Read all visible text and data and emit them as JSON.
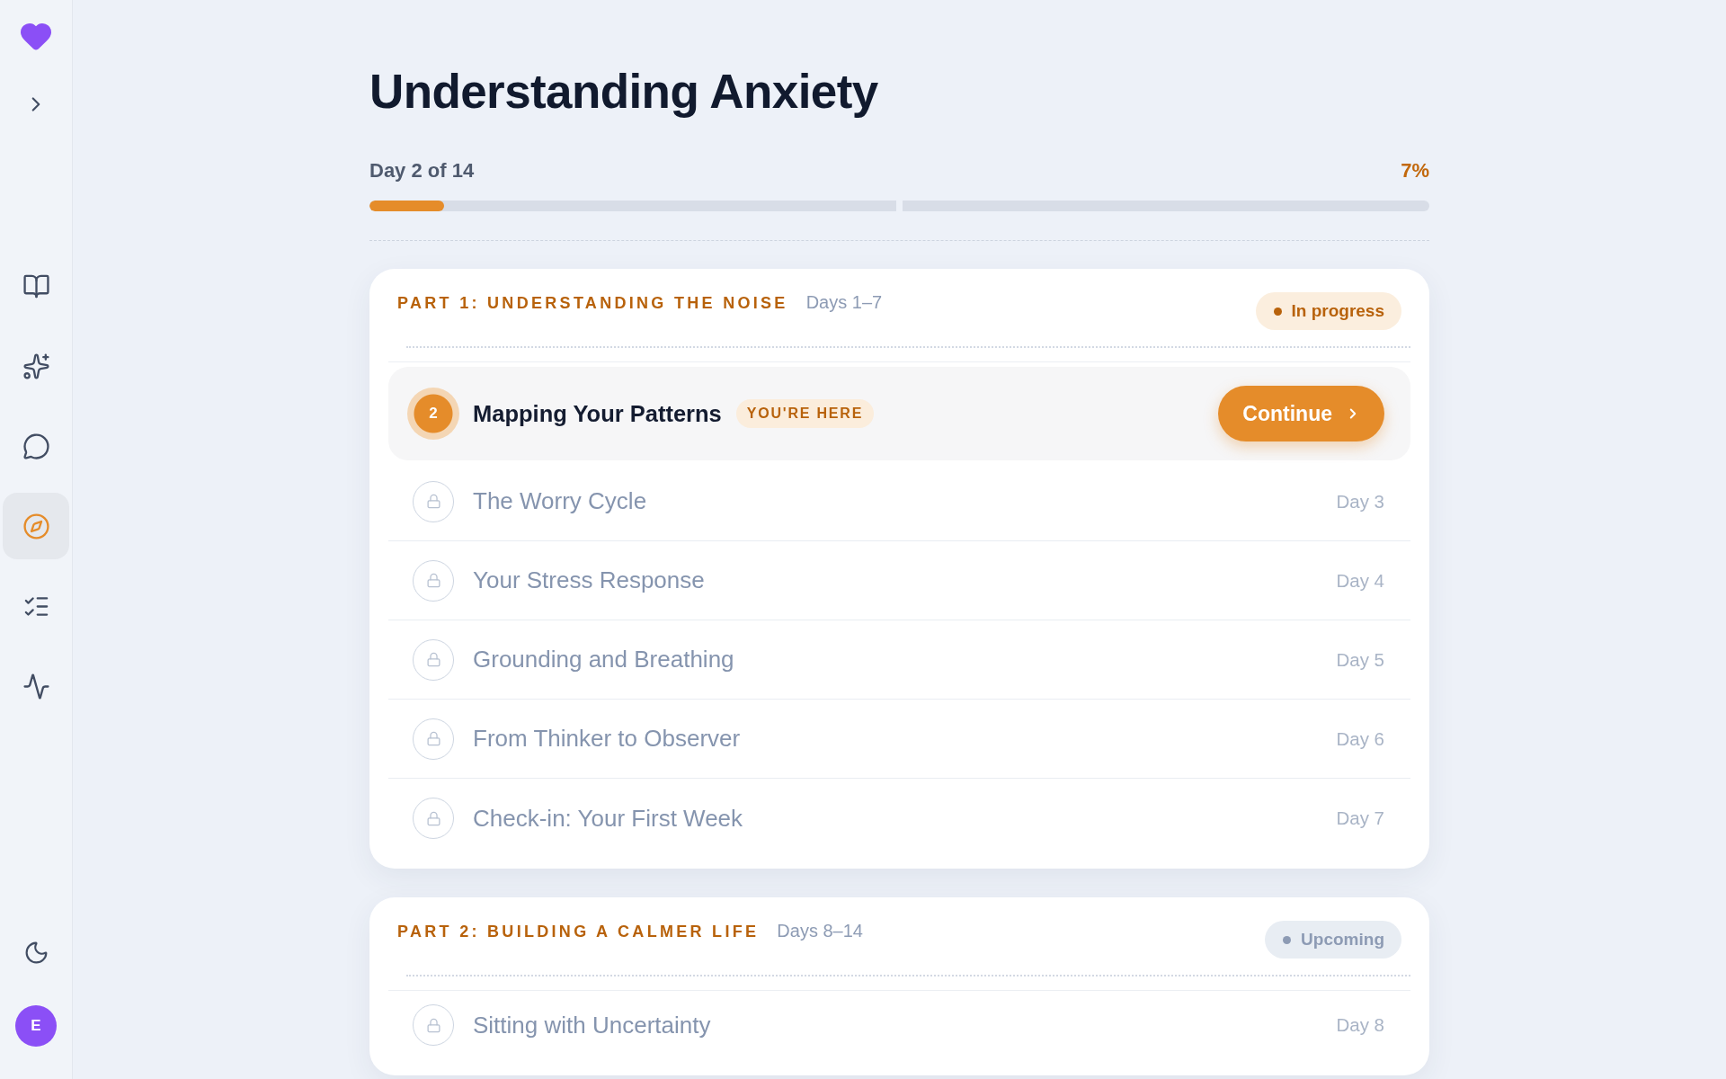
{
  "sidebar": {
    "nav": [
      {
        "selected": false
      },
      {
        "selected": false
      },
      {
        "selected": false
      },
      {
        "selected": true
      },
      {
        "selected": false
      },
      {
        "selected": false
      }
    ],
    "avatar": {
      "initial": "E"
    }
  },
  "course": {
    "title": "Understanding Anxiety",
    "progress": {
      "label": "Day 2 of 14",
      "percent": "7%",
      "level": 0.07
    }
  },
  "parts": [
    {
      "title": "PART 1: UNDERSTANDING THE NOISE",
      "days": "Days 1–7",
      "status": {
        "label": "In progress",
        "kind": "in_progress"
      },
      "lessons": [
        {
          "kind": "current",
          "number": "2",
          "title": "Mapping Your Patterns",
          "tag": "YOU'RE HERE",
          "action": "Continue"
        },
        {
          "kind": "locked",
          "title": "The Worry Cycle",
          "day": "Day 3"
        },
        {
          "kind": "locked",
          "title": "Your Stress Response",
          "day": "Day 4"
        },
        {
          "kind": "locked",
          "title": "Grounding and Breathing",
          "day": "Day 5"
        },
        {
          "kind": "locked",
          "title": "From Thinker to Observer",
          "day": "Day 6"
        },
        {
          "kind": "locked",
          "title": "Check-in: Your First Week",
          "day": "Day 7"
        }
      ]
    },
    {
      "title": "PART 2: BUILDING A CALMER LIFE",
      "days": "Days 8–14",
      "status": {
        "label": "Upcoming",
        "kind": "upcoming"
      },
      "lessons": [
        {
          "kind": "locked",
          "title": "Sitting with Uncertainty",
          "day": "Day 8"
        }
      ]
    }
  ]
}
